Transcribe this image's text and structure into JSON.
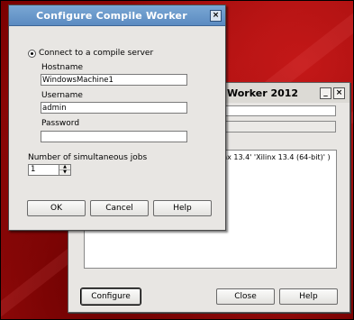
{
  "back_window": {
    "title_fragment": "Worker 2012",
    "minimize_glyph": "_",
    "close_glyph": "×",
    "list_item_fragment": "nx 13.4'  'Xilinx 13.4 (64-bit)' )",
    "configure_label": "Configure",
    "close_label": "Close",
    "help_label": "Help"
  },
  "dialog": {
    "title": "Configure Compile Worker",
    "close_glyph": "×",
    "connect_option_label": "Connect to a compile server",
    "connect_selected": true,
    "hostname_label": "Hostname",
    "hostname_value": "WindowsMachine1",
    "username_label": "Username",
    "username_value": "admin",
    "password_label": "Password",
    "password_value": "",
    "jobs_label": "Number of simultaneous jobs",
    "jobs_value": "1",
    "spin_up_glyph": "▲",
    "spin_down_glyph": "▼",
    "ok_label": "OK",
    "cancel_label": "Cancel",
    "help_label": "Help"
  }
}
